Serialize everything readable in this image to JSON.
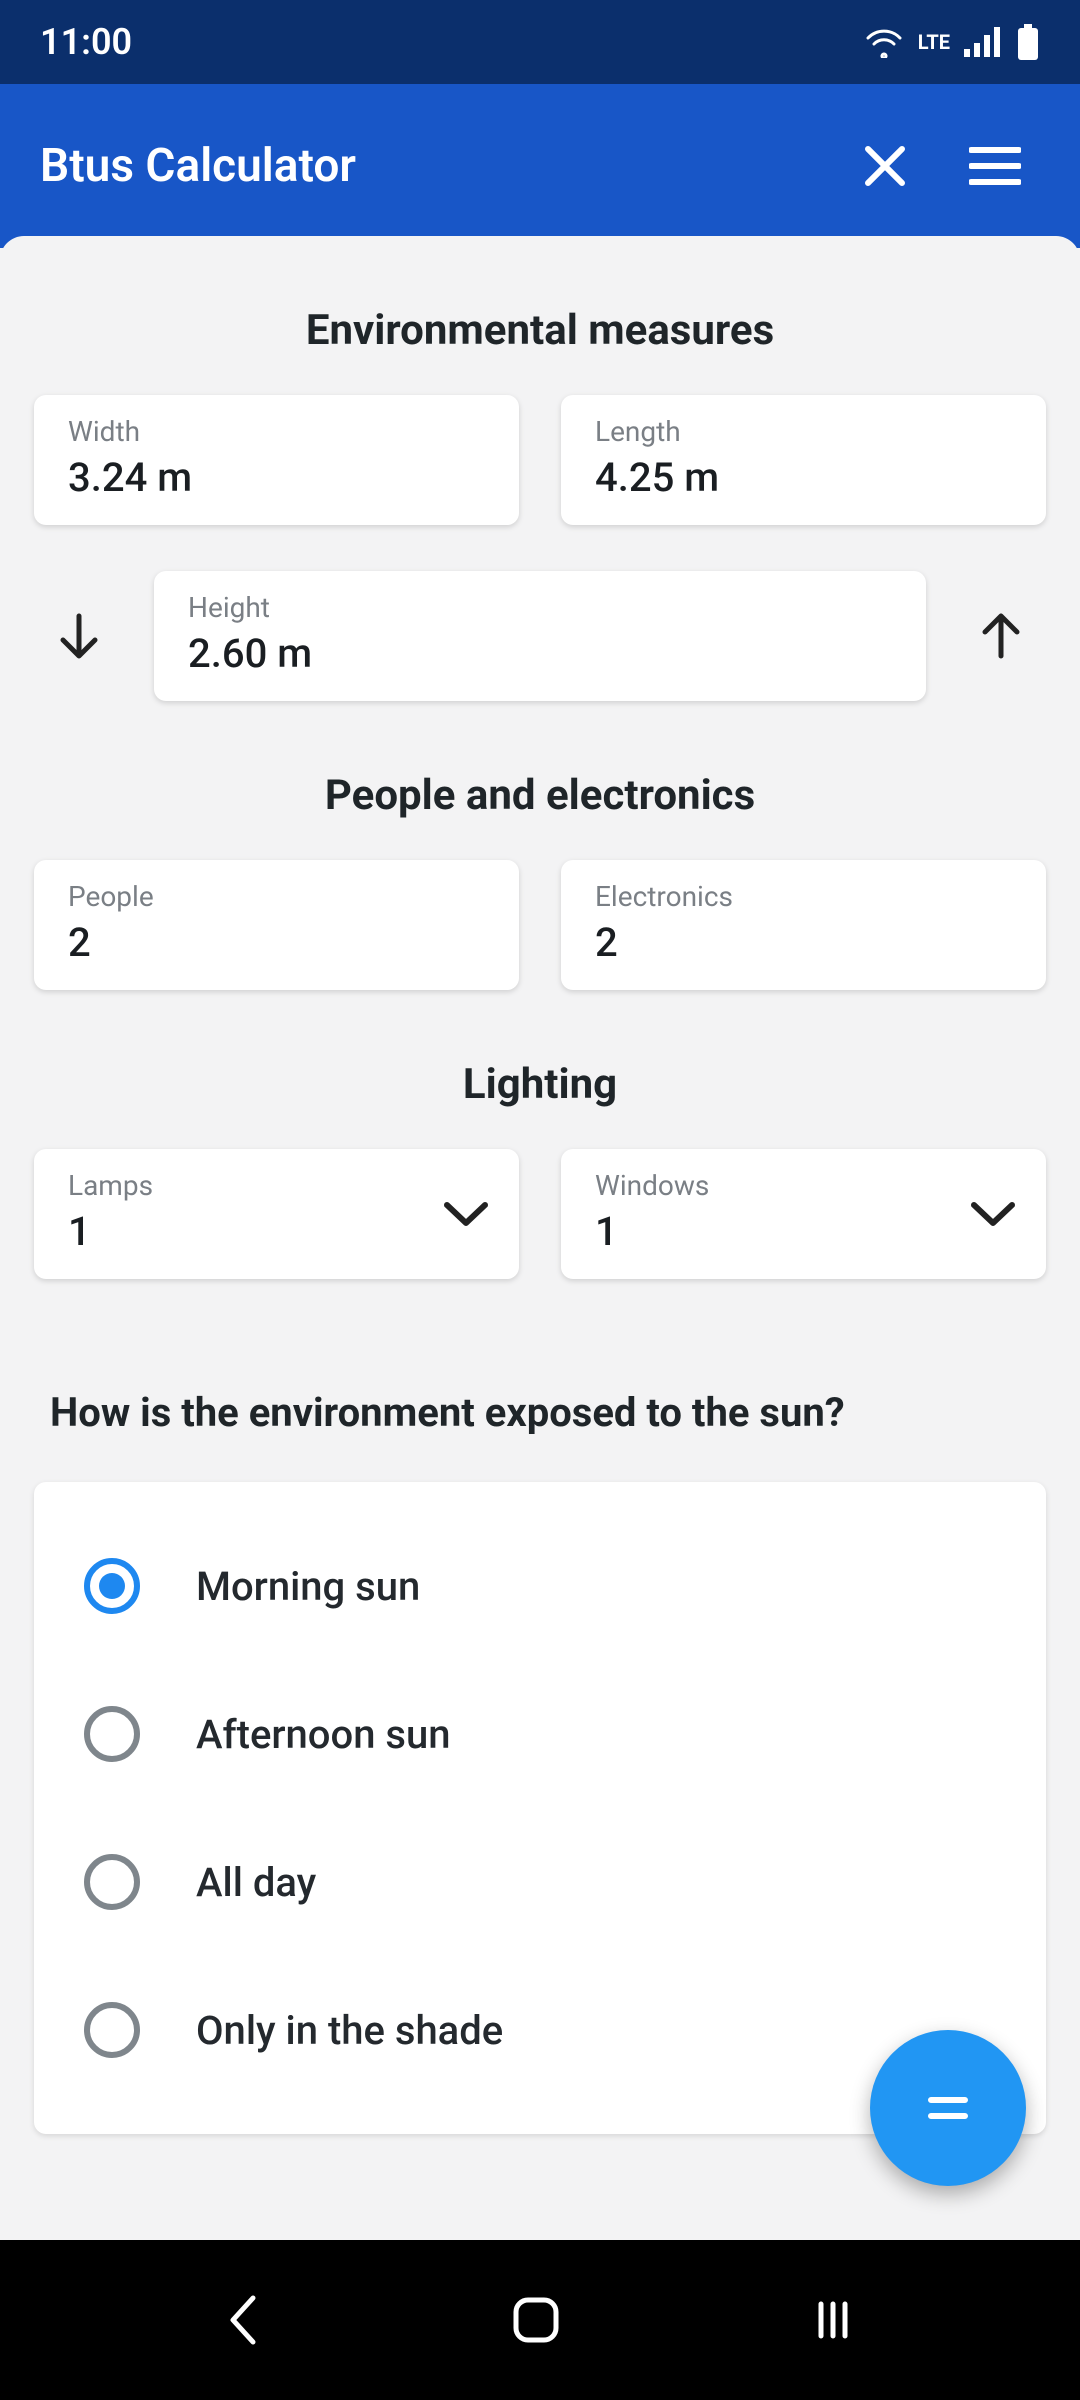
{
  "statusbar": {
    "time": "11:00",
    "network": "LTE"
  },
  "appbar": {
    "title": "Btus Calculator"
  },
  "sections": {
    "env_title": "Environmental measures",
    "people_title": "People and electronics",
    "lighting_title": "Lighting"
  },
  "fields": {
    "width": {
      "label": "Width",
      "value": "3.24 m"
    },
    "length": {
      "label": "Length",
      "value": "4.25 m"
    },
    "height": {
      "label": "Height",
      "value": "2.60 m"
    },
    "people": {
      "label": "People",
      "value": "2"
    },
    "electronics": {
      "label": "Electronics",
      "value": "2"
    },
    "lamps": {
      "label": "Lamps",
      "value": "1"
    },
    "windows": {
      "label": "Windows",
      "value": "1"
    }
  },
  "sun": {
    "question": "How is the environment exposed to the sun?",
    "options": [
      "Morning sun",
      "Afternoon sun",
      "All day",
      "Only in the shade"
    ],
    "selected": 0
  }
}
